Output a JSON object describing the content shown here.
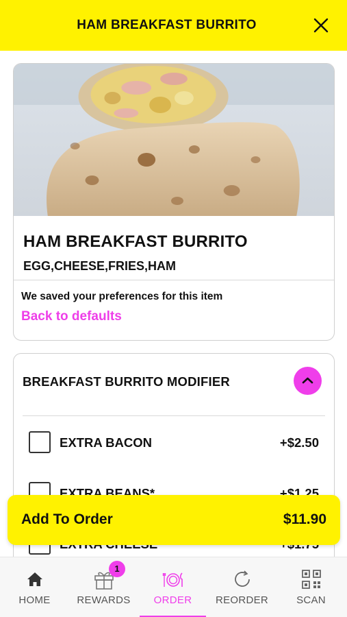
{
  "header": {
    "title": "HAM BREAKFAST BURRITO",
    "close_icon": "close-icon"
  },
  "item": {
    "name": "HAM BREAKFAST BURRITO",
    "description": "EGG,CHEESE,FRIES,HAM",
    "preferences_note": "We saved your preferences for this item",
    "back_to_defaults": "Back to defaults"
  },
  "modifier": {
    "title": "BREAKFAST BURRITO MODIFIER",
    "expanded": true,
    "options": [
      {
        "label": "EXTRA BACON",
        "price": "+$2.50",
        "checked": false
      },
      {
        "label": "EXTRA BEANS*",
        "price": "+$1.25",
        "checked": false
      },
      {
        "label": "EXTRA CHEESE",
        "price": "+$1.75",
        "checked": false
      }
    ]
  },
  "add_to_order": {
    "label": "Add To Order",
    "price": "$11.90"
  },
  "tabbar": {
    "tabs": [
      {
        "label": "HOME",
        "icon": "home-icon"
      },
      {
        "label": "REWARDS",
        "icon": "gift-icon",
        "badge": "1"
      },
      {
        "label": "ORDER",
        "icon": "plate-cutlery-icon",
        "active": true
      },
      {
        "label": "REORDER",
        "icon": "refresh-icon"
      },
      {
        "label": "SCAN",
        "icon": "qr-code-icon"
      }
    ]
  },
  "colors": {
    "brand_yellow": "#fff200",
    "accent_magenta": "#ef3eea"
  }
}
